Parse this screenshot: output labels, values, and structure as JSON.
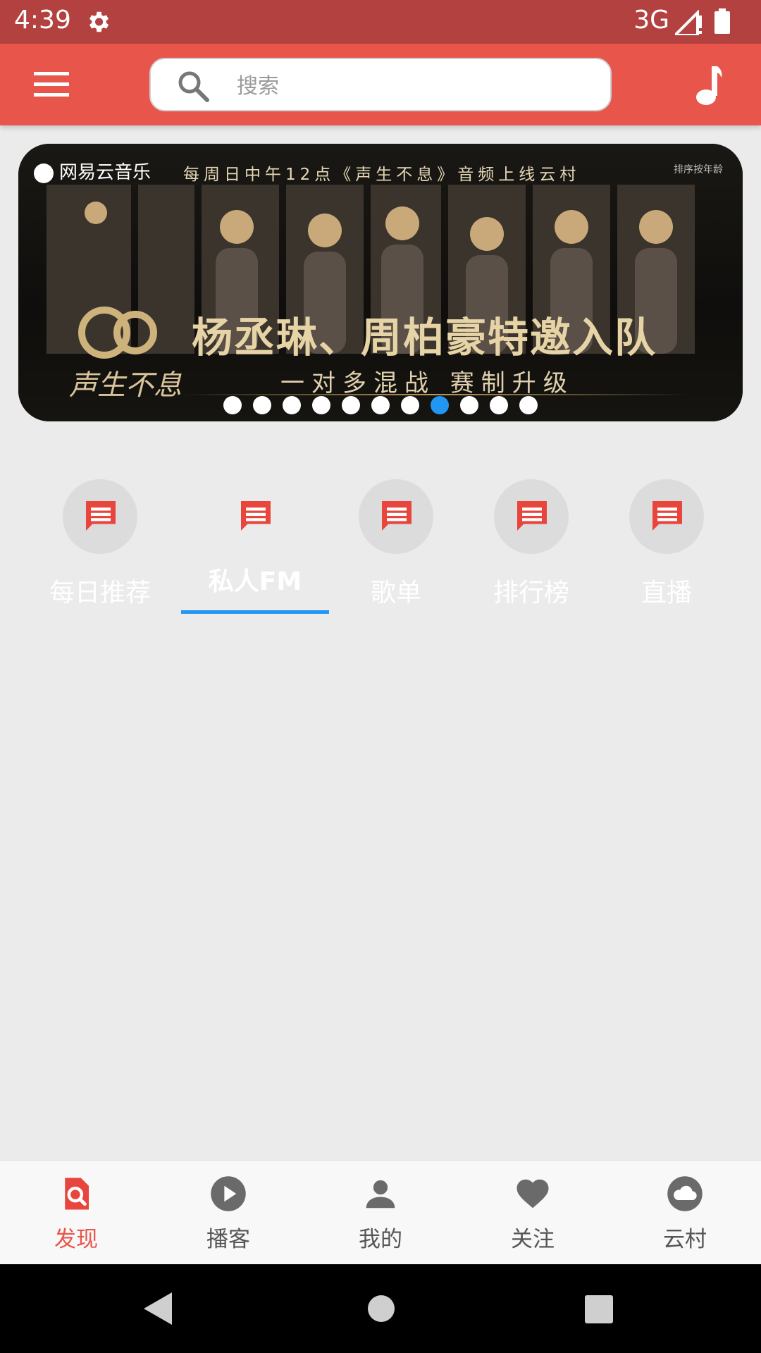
{
  "status_bar": {
    "time": "4:39",
    "network": "3G"
  },
  "search": {
    "placeholder": "搜索",
    "value": ""
  },
  "banner": {
    "brand": "网易云音乐",
    "headline": "每周日中午12点《声生不息》音频上线云村",
    "age_note": "排序按年龄",
    "show_name": "声生不息",
    "main_text": "杨丞琳、周柏豪特邀入队",
    "sub_text": "一对多混战 赛制升级",
    "page_count": 11,
    "active_index": 7
  },
  "categories": [
    {
      "label": "每日推荐",
      "icon": "message-icon"
    },
    {
      "label": "私人FM",
      "icon": "message-icon",
      "active": true
    },
    {
      "label": "歌单",
      "icon": "message-icon"
    },
    {
      "label": "排行榜",
      "icon": "message-icon"
    },
    {
      "label": "直播",
      "icon": "message-icon"
    }
  ],
  "bottom_nav": [
    {
      "label": "发现",
      "icon": "discover-icon",
      "active": true
    },
    {
      "label": "播客",
      "icon": "play-icon"
    },
    {
      "label": "我的",
      "icon": "person-icon"
    },
    {
      "label": "关注",
      "icon": "heart-icon"
    },
    {
      "label": "云村",
      "icon": "cloud-icon"
    }
  ],
  "colors": {
    "brand": "#e8554b",
    "status_bar": "#b34140",
    "accent": "#2196f3"
  }
}
